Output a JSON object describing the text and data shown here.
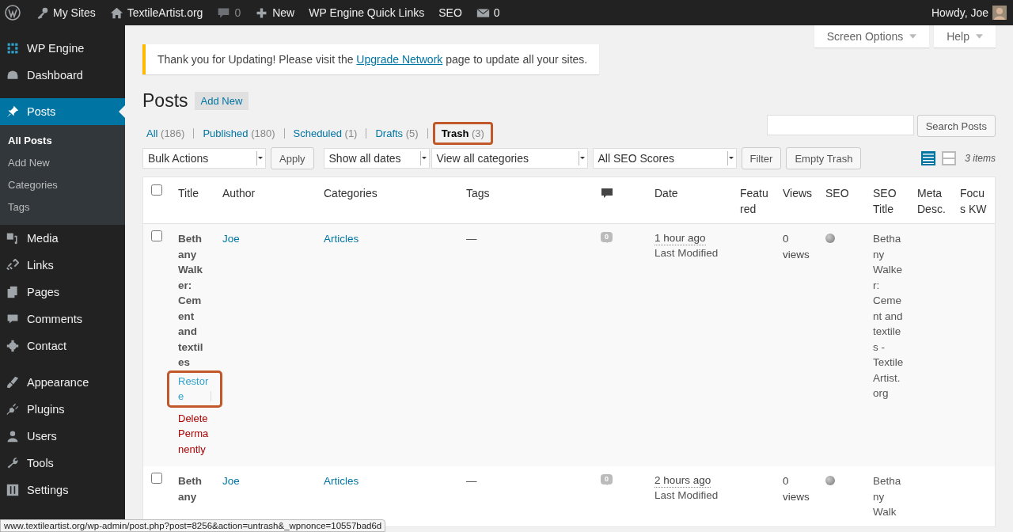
{
  "admin_bar": {
    "items": [
      {
        "kind": "logo"
      },
      {
        "kind": "sites",
        "label": "My Sites"
      },
      {
        "kind": "home",
        "label": "TextileArtist.org"
      },
      {
        "kind": "comments",
        "label": "0"
      },
      {
        "kind": "new",
        "label": "New"
      },
      {
        "kind": "text",
        "label": "WP Engine Quick Links"
      },
      {
        "kind": "text",
        "label": "SEO"
      },
      {
        "kind": "mail",
        "label": "0"
      }
    ],
    "greeting": "Howdy, Joe"
  },
  "sidebar": {
    "groups": [
      [
        {
          "kind": "grid",
          "label": "WP Engine",
          "selected": false
        },
        {
          "kind": "dashboard",
          "label": "Dashboard",
          "selected": false
        }
      ],
      [
        {
          "kind": "pin",
          "label": "Posts",
          "selected": true,
          "submenu": [
            {
              "label": "All Posts",
              "selected": true
            },
            {
              "label": "Add New",
              "selected": false
            },
            {
              "label": "Categories",
              "selected": false
            },
            {
              "label": "Tags",
              "selected": false
            }
          ]
        },
        {
          "kind": "media",
          "label": "Media",
          "selected": false
        },
        {
          "kind": "link",
          "label": "Links",
          "selected": false
        },
        {
          "kind": "pages",
          "label": "Pages",
          "selected": false
        },
        {
          "kind": "comments",
          "label": "Comments",
          "selected": false
        },
        {
          "kind": "gear",
          "label": "Contact",
          "selected": false
        }
      ],
      [
        {
          "kind": "brush",
          "label": "Appearance",
          "selected": false
        },
        {
          "kind": "plug",
          "label": "Plugins",
          "selected": false
        },
        {
          "kind": "user",
          "label": "Users",
          "selected": false
        },
        {
          "kind": "wrench",
          "label": "Tools",
          "selected": false
        },
        {
          "kind": "sliders",
          "label": "Settings",
          "selected": false
        }
      ]
    ]
  },
  "screen_meta": [
    "Screen Options",
    "Help"
  ],
  "notice": {
    "before": "Thank you for Updating! Please visit the ",
    "link": "Upgrade Network",
    "after": " page to update all your sites."
  },
  "heading": "Posts",
  "add_new": "Add New",
  "filters": [
    {
      "label": "All",
      "count": "(186)",
      "selected": false,
      "highlight": false
    },
    {
      "label": "Published",
      "count": "(180)",
      "selected": false,
      "highlight": false
    },
    {
      "label": "Scheduled",
      "count": "(1)",
      "selected": false,
      "highlight": false
    },
    {
      "label": "Drafts",
      "count": "(5)",
      "selected": false,
      "highlight": false
    },
    {
      "label": "Trash",
      "count": "(3)",
      "selected": true,
      "highlight": true
    }
  ],
  "search": {
    "button": "Search Posts"
  },
  "toolbar": [
    {
      "kind": "select",
      "value": "Bulk Actions"
    },
    {
      "kind": "button",
      "label": "Apply"
    },
    {
      "kind": "select",
      "value": "Show all dates"
    },
    {
      "kind": "select",
      "value": "View all categories"
    },
    {
      "kind": "select",
      "value": "All SEO Scores"
    },
    {
      "kind": "button",
      "label": "Filter"
    },
    {
      "kind": "button",
      "label": "Empty Trash"
    }
  ],
  "view_modes": [
    {
      "kind": "list",
      "selected": true
    },
    {
      "kind": "excerpt",
      "selected": false
    }
  ],
  "items_count": "3 items",
  "columns": [
    {
      "kind": "check",
      "checked": false
    },
    {
      "kind": "text",
      "label": "Title"
    },
    {
      "kind": "text",
      "label": "Author"
    },
    {
      "kind": "text",
      "label": "Categories"
    },
    {
      "kind": "text",
      "label": "Tags"
    },
    {
      "kind": "comments"
    },
    {
      "kind": "text",
      "label": "Date"
    },
    {
      "kind": "text",
      "label": "Featured"
    },
    {
      "kind": "text",
      "label": "Views"
    },
    {
      "kind": "text",
      "label": "SEO"
    },
    {
      "kind": "text",
      "label": "SEO Title"
    },
    {
      "kind": "text",
      "label": "Meta Desc."
    },
    {
      "kind": "text",
      "label": "Focus KW"
    }
  ],
  "rows": [
    {
      "checked": false,
      "title": "Bethany Walker: Cement and textiles",
      "actions": [
        {
          "kind": "restore",
          "label": "Restore",
          "highlight": true
        },
        {
          "kind": "delete",
          "label": "Delete Permanently",
          "highlight": false
        }
      ],
      "author": "Joe",
      "categories": "Articles",
      "tags": "—",
      "comments": "0",
      "date": "1 hour ago",
      "date_note": "Last Modified",
      "views": "0 views",
      "seo_title": "Bethany Walker: Cement and textiles - TextileArtist.org"
    },
    {
      "checked": false,
      "title": "Bethany",
      "actions": [],
      "author": "Joe",
      "categories": "Articles",
      "tags": "—",
      "comments": "0",
      "date": "2 hours ago",
      "date_note": "Last Modified",
      "views": "0 views",
      "seo_title": "Bethany Walk"
    }
  ],
  "status_url": "www.textileartist.org/wp-admin/post.php?post=8256&action=untrash&_wpnonce=10557bad6d"
}
